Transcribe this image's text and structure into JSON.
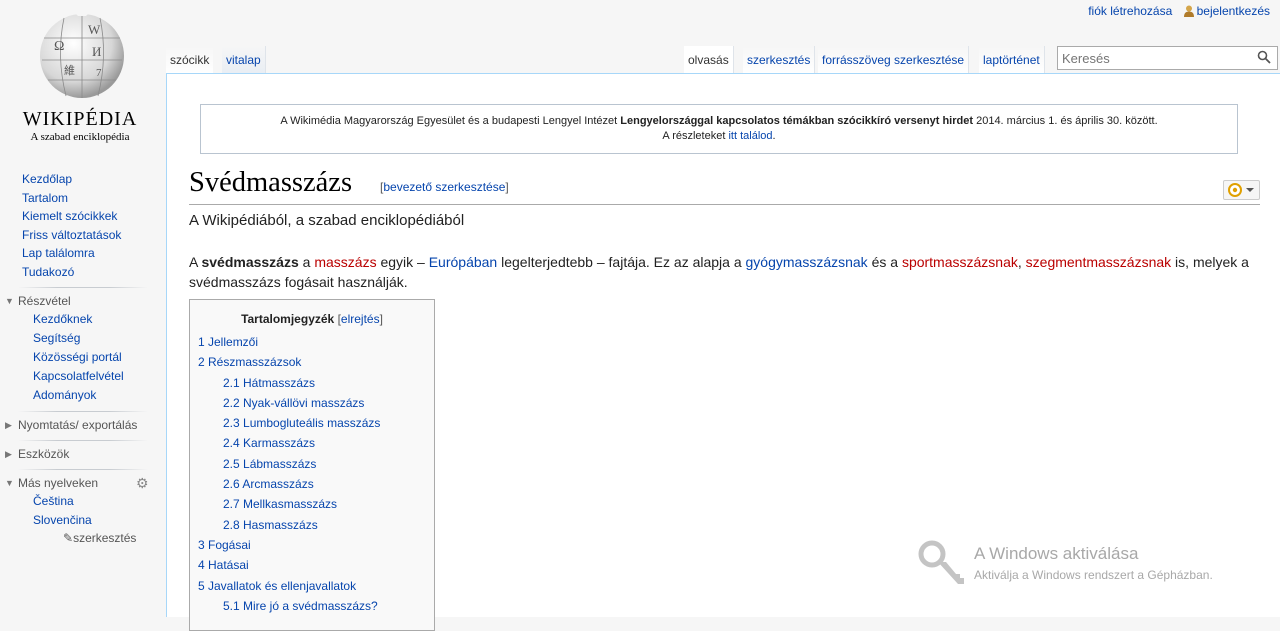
{
  "personal": {
    "create_account": "fiók létrehozása",
    "login": "bejelentkezés"
  },
  "logo": {
    "wordmark": "WIKIPÉDIA",
    "tagline": "A szabad enciklopédia"
  },
  "sidebar": {
    "nav": [
      "Kezdőlap",
      "Tartalom",
      "Kiemelt szócikkek",
      "Friss változtatások",
      "Lap találomra",
      "Tudakozó"
    ],
    "participation": {
      "heading": "Részvétel",
      "items": [
        "Kezdőknek",
        "Segítség",
        "Közösségi portál",
        "Kapcsolatfelvétel",
        "Adományok"
      ]
    },
    "print_export": "Nyomtatás/ exportálás",
    "tools": "Eszközök",
    "languages": {
      "heading": "Más nyelveken",
      "items": [
        "Čeština",
        "Slovenčina"
      ],
      "edit_links": "szerkesztés"
    }
  },
  "tabs": {
    "article": "szócikk",
    "talk": "vitalap",
    "read": "olvasás",
    "edit": "szerkesztés",
    "edit_source": "forrásszöveg szerkesztése",
    "history": "laptörténet"
  },
  "search": {
    "placeholder": "Keresés"
  },
  "sitenotice": {
    "part1": "A Wikimédia Magyarország Egyesület és a budapesti Lengyel Intézet ",
    "bold": "Lengyelországgal kapcsolatos témákban szócikkíró versenyt hirdet",
    "part2": " 2014. március 1. és április 30. között.",
    "line2_prefix": "A részleteket ",
    "line2_link": "itt találod",
    "line2_suffix": "."
  },
  "article": {
    "title": "Svédmasszázs",
    "section_edit_open": "[",
    "section_edit": "bevezető szerkesztése",
    "section_edit_close": "]",
    "site_sub": "A Wikipédiából, a szabad enciklopédiából",
    "intro": {
      "t1": "A ",
      "bold": "svédmasszázs",
      "t2": " a ",
      "link_massage": "masszázs",
      "t3": " egyik – ",
      "link_europe": "Európában",
      "t4": " legelterjedtebb – fajtája. Ez az alapja a ",
      "link_gyogy": "gyógymasszázsnak",
      "t5": " és a ",
      "link_sport": "sportmasszázsnak",
      "t6": ", ",
      "link_segment": "szegmentmasszázsnak",
      "t7": " is, melyek a svédmasszázs fogásait használják."
    }
  },
  "toc": {
    "title": "Tartalomjegyzék",
    "hide_open": "[",
    "hide": "elrejtés",
    "hide_close": "]",
    "items": [
      {
        "level": 1,
        "text": "1 Jellemzői"
      },
      {
        "level": 1,
        "text": "2 Részmasszázsok"
      },
      {
        "level": 2,
        "text": "2.1 Hátmasszázs"
      },
      {
        "level": 2,
        "text": "2.2 Nyak-vállövi masszázs"
      },
      {
        "level": 2,
        "text": "2.3 Lumbogluteális masszázs"
      },
      {
        "level": 2,
        "text": "2.4 Karmasszázs"
      },
      {
        "level": 2,
        "text": "2.5 Lábmasszázs"
      },
      {
        "level": 2,
        "text": "2.6 Arcmasszázs"
      },
      {
        "level": 2,
        "text": "2.7 Mellkasmasszázs"
      },
      {
        "level": 2,
        "text": "2.8 Hasmasszázs"
      },
      {
        "level": 1,
        "text": "3 Fogásai"
      },
      {
        "level": 1,
        "text": "4 Hatásai"
      },
      {
        "level": 1,
        "text": "5 Javallatok és ellenjavallatok"
      },
      {
        "level": 2,
        "text": "5.1 Mire jó a svédmasszázs?"
      }
    ]
  },
  "windows_watermark": {
    "title": "A Windows aktiválása",
    "subtitle": "Aktiválja a Windows rendszert a Gépházban."
  },
  "colors": {
    "link": "#0645ad",
    "redlink": "#ba0000",
    "border_blue": "#a7d7f9"
  }
}
